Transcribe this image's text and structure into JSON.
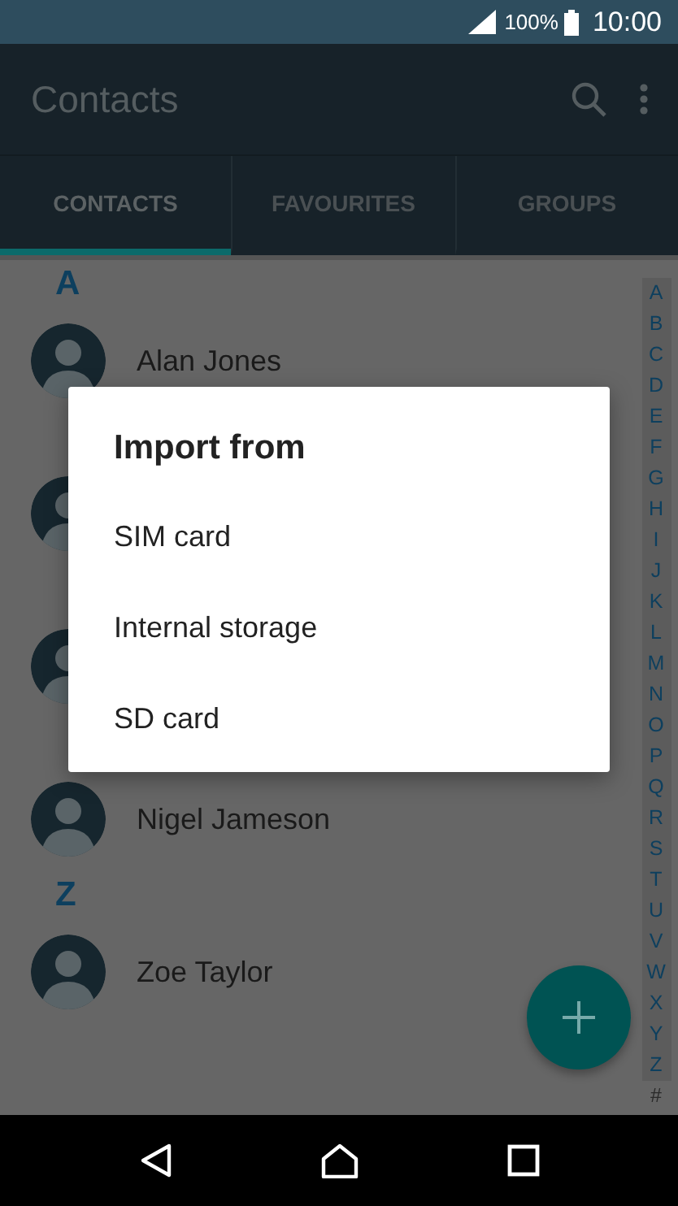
{
  "status_bar": {
    "battery": "100%",
    "time": "10:00"
  },
  "app_bar": {
    "title": "Contacts"
  },
  "tabs": [
    {
      "label": "CONTACTS",
      "selected": true
    },
    {
      "label": "FAVOURITES",
      "selected": false
    },
    {
      "label": "GROUPS",
      "selected": false
    }
  ],
  "sections": [
    {
      "letter": "A",
      "contacts": [
        {
          "kind": "named",
          "name": "Alan Jones"
        }
      ]
    },
    {
      "contacts": [
        {
          "kind": "avatar_only"
        }
      ]
    },
    {
      "contacts": [
        {
          "kind": "avatar_only"
        }
      ]
    },
    {
      "contacts": [
        {
          "kind": "named",
          "name": "Nigel Jameson"
        }
      ]
    },
    {
      "letter": "Z",
      "contacts": [
        {
          "kind": "named",
          "name": "Zoe Taylor"
        }
      ]
    }
  ],
  "index": [
    "A",
    "B",
    "C",
    "D",
    "E",
    "F",
    "G",
    "H",
    "I",
    "J",
    "K",
    "L",
    "M",
    "N",
    "O",
    "P",
    "Q",
    "R",
    "S",
    "T",
    "U",
    "V",
    "W",
    "X",
    "Y",
    "Z",
    "#"
  ],
  "dialog": {
    "title": "Import from",
    "options": [
      "SIM card",
      "Internal storage",
      "SD card"
    ]
  }
}
